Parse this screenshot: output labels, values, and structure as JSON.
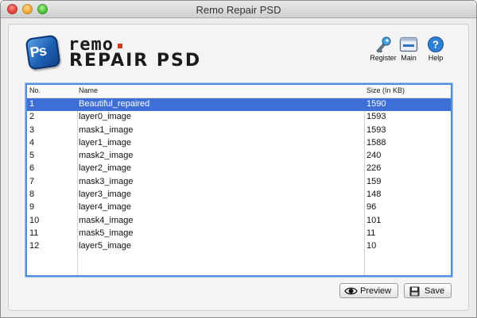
{
  "window": {
    "title": "Remo Repair PSD"
  },
  "logo": {
    "icon_text": "Ps",
    "line1": "remo",
    "line2": "REPAIR PSD"
  },
  "toolbar": {
    "register_label": "Register",
    "main_label": "Main",
    "help_label": "Help"
  },
  "table": {
    "headers": {
      "no": "No.",
      "name": "Name",
      "size": "Size (In KB)"
    },
    "rows": [
      {
        "no": "1",
        "name": "Beautiful_repaired",
        "size": "1590",
        "selected": true
      },
      {
        "no": "2",
        "name": "layer0_image",
        "size": "1593"
      },
      {
        "no": "3",
        "name": "mask1_image",
        "size": "1593"
      },
      {
        "no": "4",
        "name": "layer1_image",
        "size": "1588"
      },
      {
        "no": "5",
        "name": "mask2_image",
        "size": "240"
      },
      {
        "no": "6",
        "name": "layer2_image",
        "size": "226"
      },
      {
        "no": "7",
        "name": "mask3_image",
        "size": "159"
      },
      {
        "no": "8",
        "name": "layer3_image",
        "size": "148"
      },
      {
        "no": "9",
        "name": "layer4_image",
        "size": "96"
      },
      {
        "no": "10",
        "name": "mask4_image",
        "size": "101"
      },
      {
        "no": "11",
        "name": "mask5_image",
        "size": "11"
      },
      {
        "no": "12",
        "name": "layer5_image",
        "size": "10"
      }
    ]
  },
  "buttons": {
    "preview_label": "Preview",
    "save_label": "Save"
  },
  "colors": {
    "selection": "#3d6fd6",
    "table_border": "#4f8fdc",
    "logo_accent": "#d23a1e"
  }
}
